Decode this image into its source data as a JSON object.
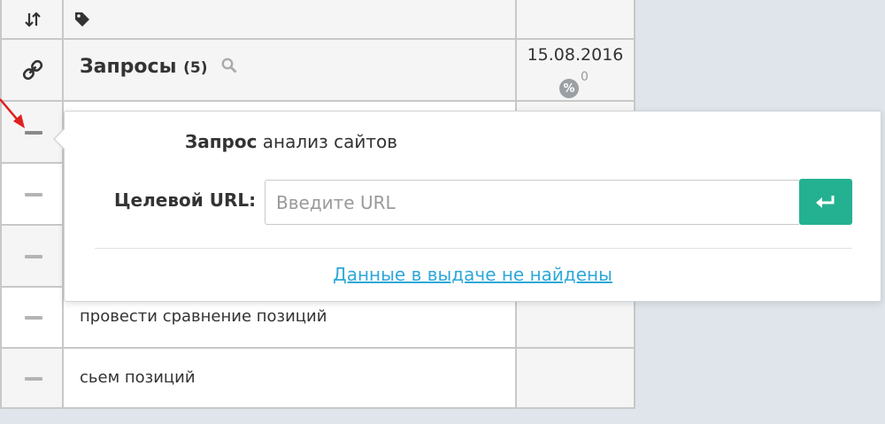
{
  "header": {
    "queries_title": "Запросы",
    "queries_count": "(5)",
    "date_column": "15.08.2016",
    "percent_symbol": "%",
    "percent_value": "0"
  },
  "rows": [
    {
      "text": ""
    },
    {
      "text": ""
    },
    {
      "text": ""
    },
    {
      "text": "провести сравнение позиций"
    },
    {
      "text": "сьем позиций"
    }
  ],
  "popup": {
    "query_prefix": "Запрос",
    "query_text": "анализ сайтов",
    "url_label": "Целевой URL:",
    "url_placeholder": "Введите URL",
    "url_value": "",
    "not_found_link": "Данные в выдаче не найдены"
  },
  "colors": {
    "accent": "#23b191",
    "link": "#2fa8d8",
    "arrow": "#e02020"
  }
}
